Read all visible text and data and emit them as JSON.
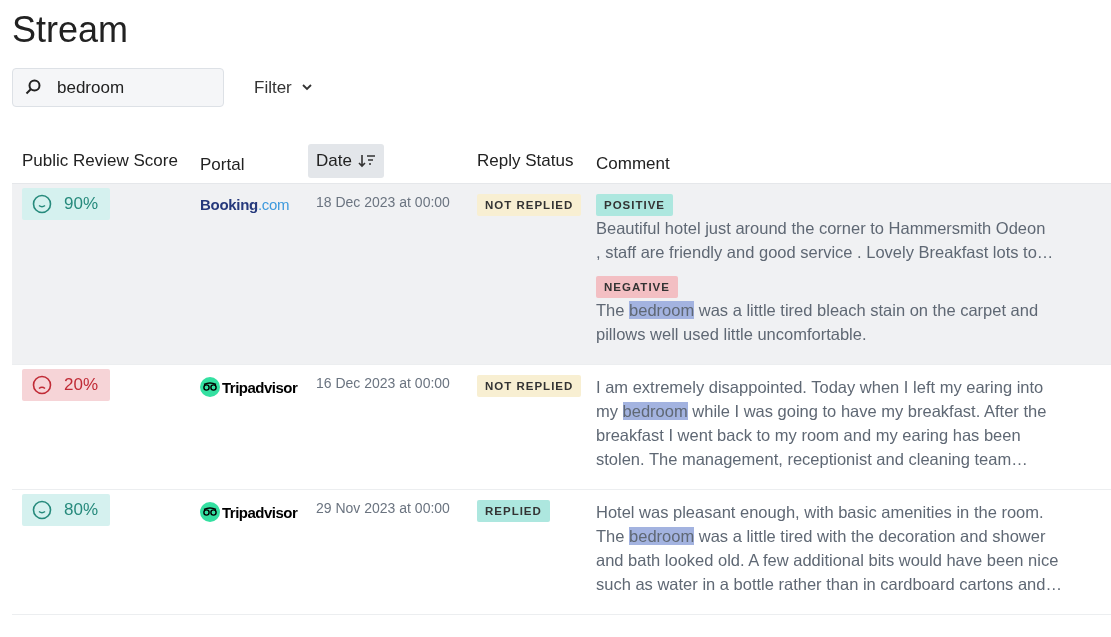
{
  "title": "Stream",
  "search": {
    "value": "bedroom"
  },
  "filter": {
    "label": "Filter"
  },
  "table": {
    "columns": [
      {
        "label": "Public Review Score",
        "selected": false
      },
      {
        "label": "Portal",
        "selected": false
      },
      {
        "label": "Date",
        "selected": true
      },
      {
        "label": "Reply Status",
        "selected": false
      },
      {
        "label": "Comment",
        "selected": false
      }
    ],
    "rows": [
      {
        "selected": true,
        "score": "90%",
        "positive": true,
        "portal": {
          "kind": "booking",
          "name": "Booking",
          "suffix": ".com"
        },
        "date": "18 Dec 2023 at 00:00",
        "status": {
          "label": "NOT REPLIED",
          "replied": false
        },
        "comments": [
          {
            "tag": {
              "label": "POSITIVE",
              "kind": "positive"
            },
            "segments": [
              {
                "text": "Beautiful hotel just around the corner to Hammersmith Odeon\n, staff are friendly and good service . Lovely Breakfast lots to…",
                "highlight": false
              }
            ]
          },
          {
            "tag": {
              "label": "NEGATIVE",
              "kind": "negative"
            },
            "segments": [
              {
                "text": "The ",
                "highlight": false
              },
              {
                "text": "bedroom",
                "highlight": true
              },
              {
                "text": " was a little tired bleach stain on the carpet and\npillows well used little uncomfortable.",
                "highlight": false
              }
            ]
          }
        ]
      },
      {
        "selected": false,
        "score": "20%",
        "positive": false,
        "portal": {
          "kind": "tripadvisor",
          "name": "Tripadvisor"
        },
        "date": "16 Dec 2023 at 00:00",
        "status": {
          "label": "NOT REPLIED",
          "replied": false
        },
        "comments": [
          {
            "segments": [
              {
                "text": "I am extremely disappointed. Today when I left my earing into\nmy ",
                "highlight": false
              },
              {
                "text": "bedroom",
                "highlight": true
              },
              {
                "text": " while I was going to have my breakfast. After the\nbreakfast I went back to my room and my earing has been\nstolen. The management, receptionist and cleaning team…",
                "highlight": false
              }
            ]
          }
        ]
      },
      {
        "selected": false,
        "score": "80%",
        "positive": true,
        "portal": {
          "kind": "tripadvisor",
          "name": "Tripadvisor"
        },
        "date": "29 Nov 2023 at 00:00",
        "status": {
          "label": "REPLIED",
          "replied": true
        },
        "comments": [
          {
            "segments": [
              {
                "text": "Hotel was pleasant enough, with basic amenities in the room.\nThe ",
                "highlight": false
              },
              {
                "text": "bedroom",
                "highlight": true
              },
              {
                "text": " was a little tired with the decoration and shower\nand bath looked old. A few additional bits would have been nice\nsuch as water in a bottle rather than in cardboard cartons and…",
                "highlight": false
              }
            ]
          }
        ]
      }
    ]
  }
}
